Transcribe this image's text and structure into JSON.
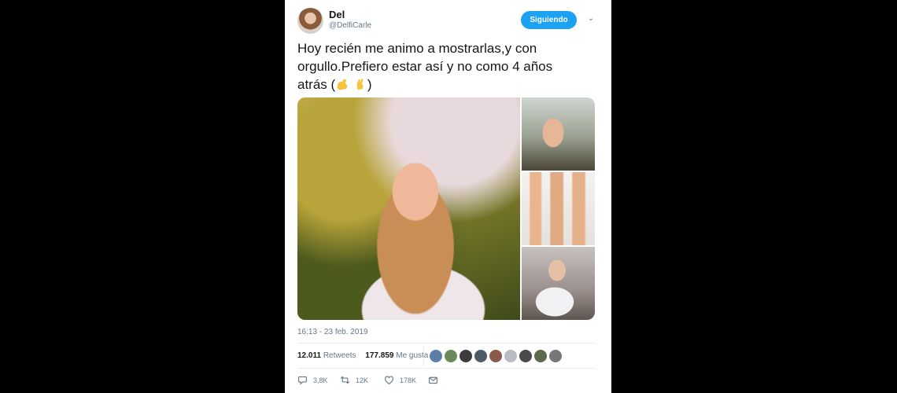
{
  "user": {
    "name": "Del",
    "handle": "@DelfiCarle"
  },
  "follow_label": "Siguiendo",
  "tweet": {
    "line1": "Hoy recién me animo a mostrarlas,y con",
    "line2": "orgullo.Prefiero estar así y no como 4 años",
    "line3_prefix": "atrás (",
    "line3_suffix": ")"
  },
  "emojis": [
    "flexed-biceps-icon",
    "crossed-fingers-icon"
  ],
  "timestamp": "16:13 - 23 feb. 2019",
  "stats": {
    "retweets_count": "12.011",
    "retweets_label": "Retweets",
    "likes_count": "177.859",
    "likes_label": "Me gusta"
  },
  "liker_colors": [
    "#5b7fa8",
    "#6a8a5a",
    "#3c3c3c",
    "#4e5a66",
    "#8a5a4a",
    "#b9bcc4",
    "#4a4a4a",
    "#5d6a4e",
    "#777777"
  ],
  "actions": {
    "reply": "3,8K",
    "retweet": "12K",
    "like": "178K"
  },
  "colors": {
    "accent": "#1da1f2",
    "muted": "#657786"
  }
}
